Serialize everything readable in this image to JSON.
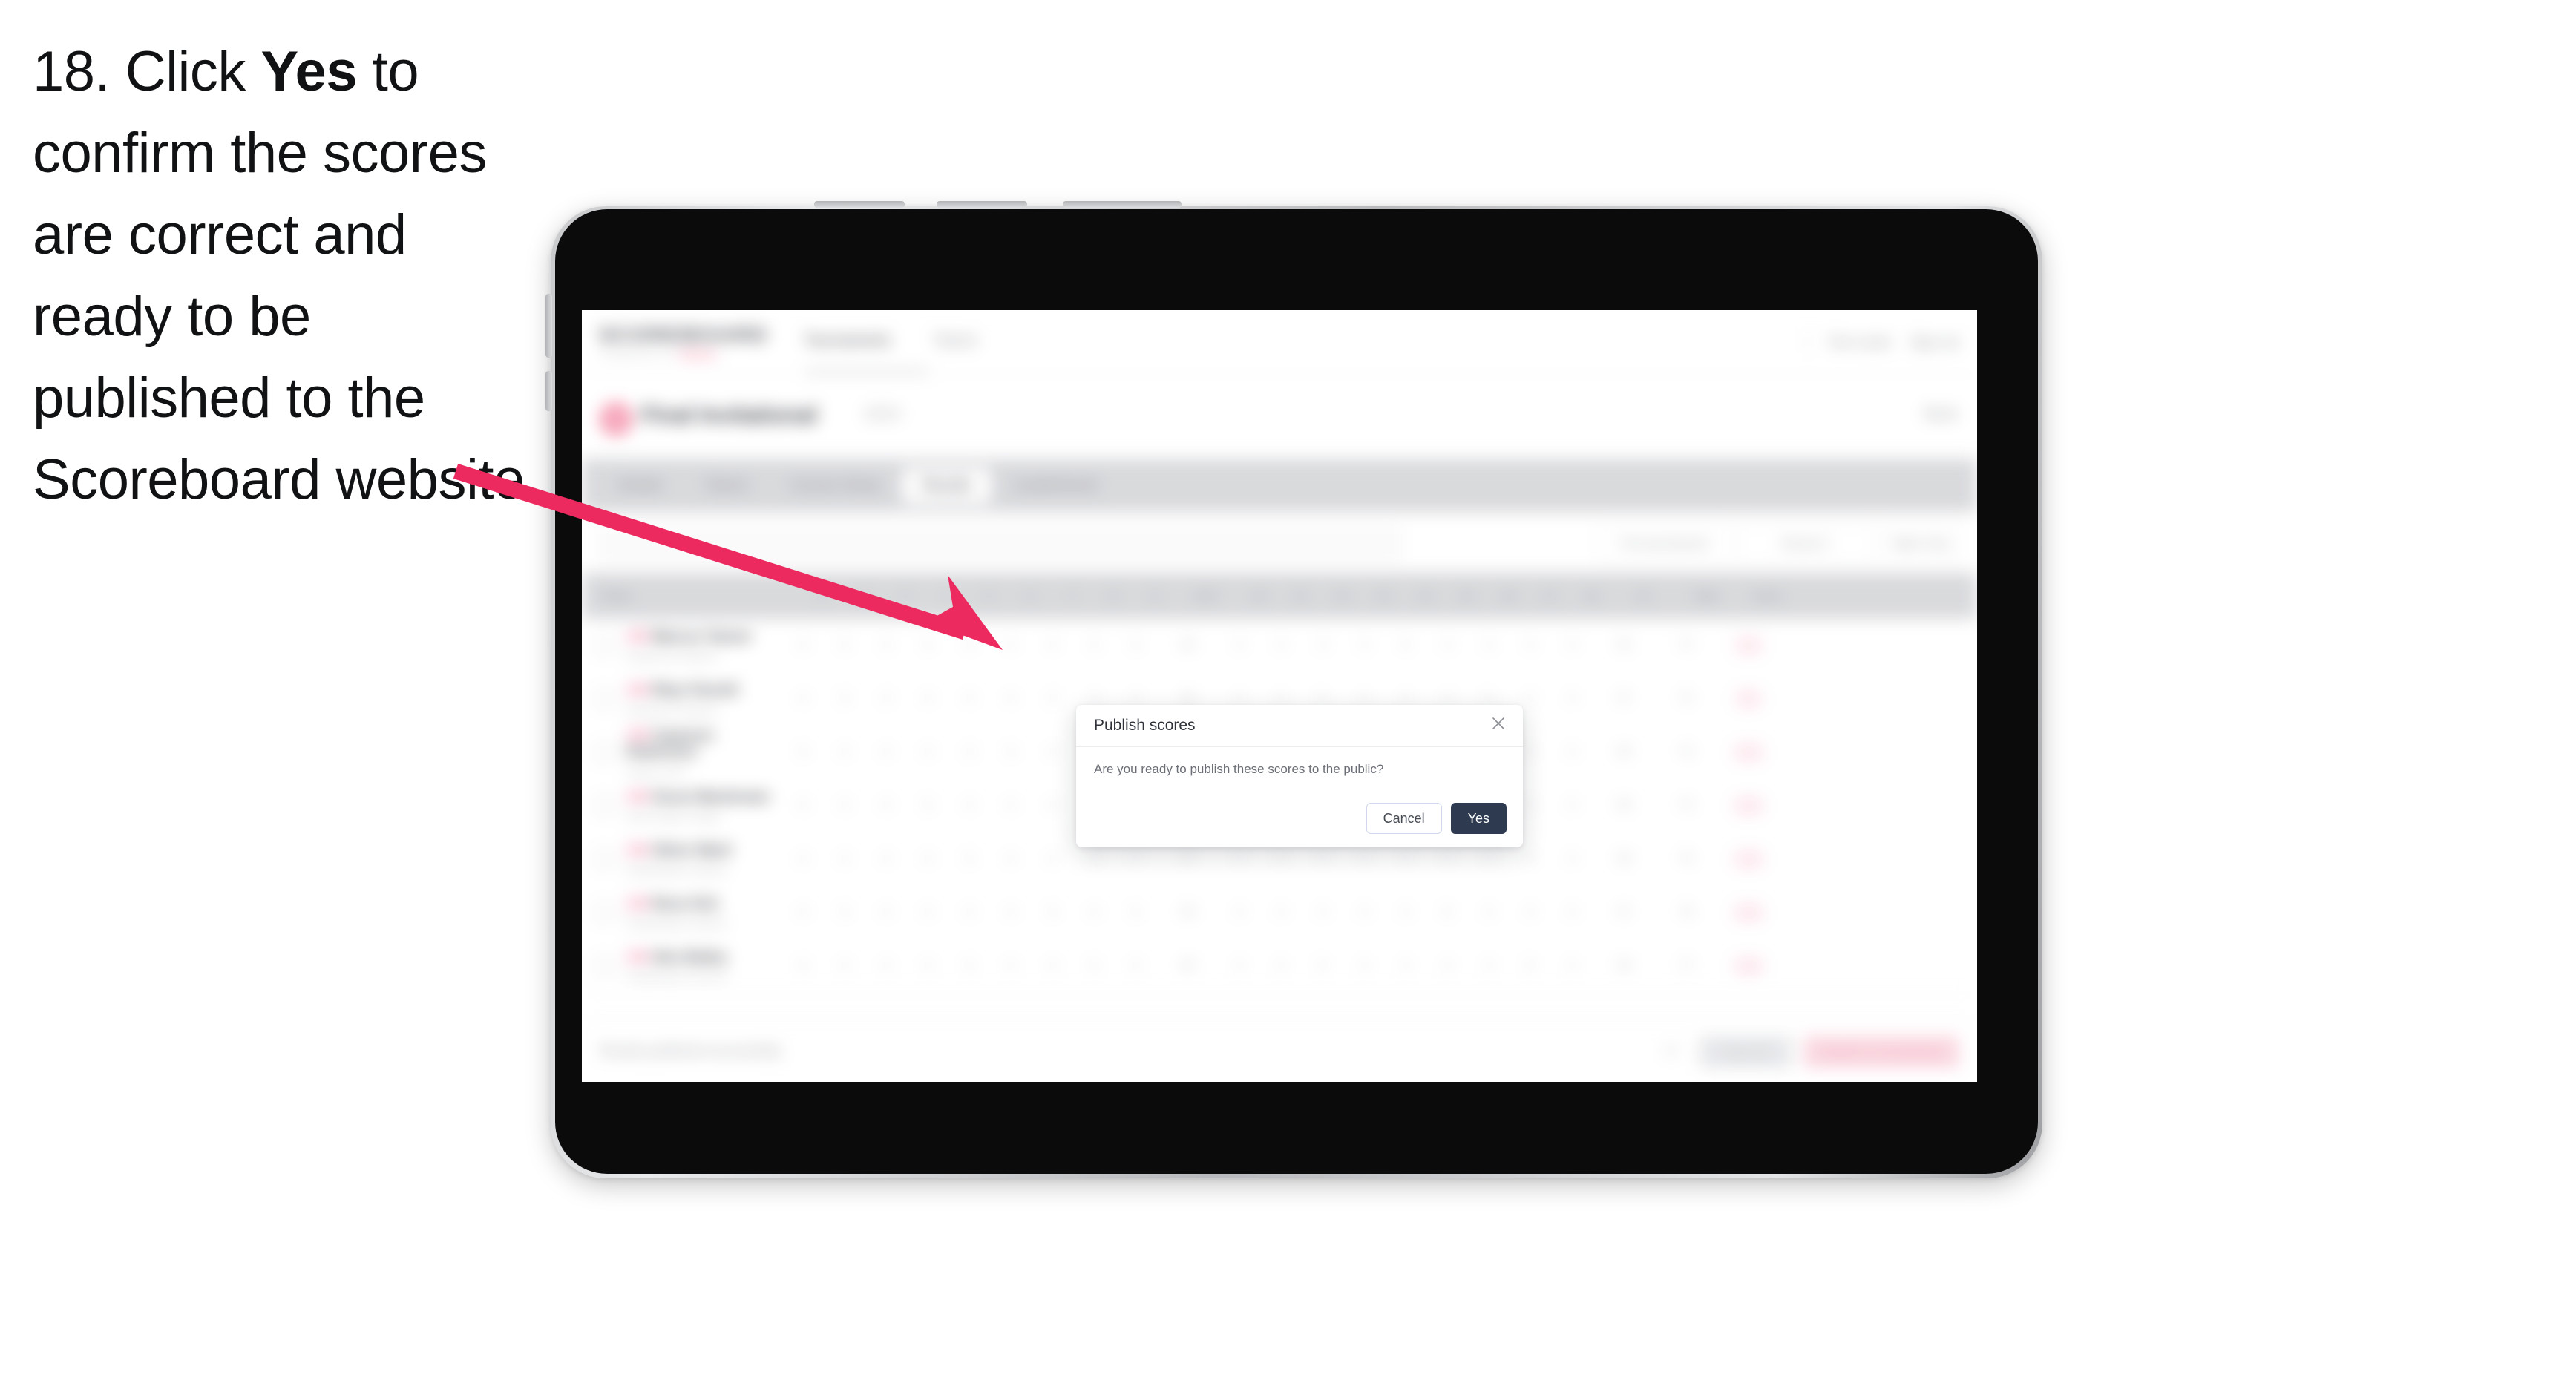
{
  "instruction": {
    "prefix": "18. Click ",
    "keyword": "Yes",
    "suffix": " to confirm the scores are correct and ready to be published to the Scoreboard website."
  },
  "colors": {
    "arrow": "#ED2A5F",
    "accent_pink": "#EF3B68",
    "primary_button": "#2D3A50",
    "device_frame": "#0B0B0C"
  },
  "modal": {
    "title": "Publish scores",
    "message": "Are you ready to publish these scores to the public?",
    "close_label": "close-icon",
    "cancel_label": "Cancel",
    "confirm_label": "Yes"
  },
  "app": {
    "brand": {
      "name": "SCOREBOARD",
      "tagline_plain": "POWERED BY",
      "tagline_accent": "TRACK"
    },
    "topnav": [
      {
        "label": "Tournaments"
      },
      {
        "label": "Teams"
      }
    ],
    "topright": [
      {
        "label": "Tom Lewis"
      },
      {
        "label": "Sign out"
      }
    ],
    "page_header": {
      "title": "Final Invitational",
      "subtitle": "2024",
      "right_action": "Back"
    },
    "tabs": [
      {
        "label": "Details"
      },
      {
        "label": "Teams"
      },
      {
        "label": "Course Setup"
      },
      {
        "label": "Results"
      },
      {
        "label": "Leaderboard"
      }
    ],
    "selected_tab": "Results",
    "filters": {
      "search_placeholder": "Search players",
      "control_1": "Pre-tournament",
      "control_2": "Round 1",
      "control_3": "Table Only"
    },
    "table": {
      "columns": [
        "Player",
        "1",
        "2",
        "3",
        "4",
        "5",
        "6",
        "7",
        "8",
        "9",
        "OUT",
        "10",
        "11",
        "12",
        "13",
        "14",
        "15",
        "16",
        "17",
        "18",
        "IN",
        "Total",
        "Score"
      ],
      "rows": [
        {
          "name_prefix": "AM",
          "name": "Marcus Tanner",
          "team": "Eastwood Academy",
          "out": "36",
          "in": "35",
          "total": "71",
          "score": "-1"
        },
        {
          "name_prefix": "AM",
          "name": "Rhys Parnell",
          "team": "Eastwood Academy",
          "out": "35",
          "in": "37",
          "total": "72",
          "score": "E"
        },
        {
          "name_prefix": "AM",
          "name": "Cameron Robertson",
          "team": "Harbor Point",
          "out": "37",
          "in": "36",
          "total": "73",
          "score": "+1"
        },
        {
          "name_prefix": "AM",
          "name": "Oscar Maclennan",
          "team": "North Ridge College",
          "out": "38",
          "in": "36",
          "total": "74",
          "score": "+2"
        },
        {
          "name_prefix": "AM",
          "name": "Oliver Ward",
          "team": "Kingsbridge Academy",
          "out": "37",
          "in": "38",
          "total": "75",
          "score": "+3"
        },
        {
          "name_prefix": "AM",
          "name": "Ross Kirk",
          "team": "Kingsbridge Academy",
          "out": "39",
          "in": "37",
          "total": "76",
          "score": "+4"
        },
        {
          "name_prefix": "AM",
          "name": "Alex Bailey",
          "team": "Kingsbridge Academy",
          "out": "39",
          "in": "38",
          "total": "77",
          "score": "+5"
        }
      ]
    },
    "footer": {
      "status": "Results published successfully",
      "count": "14",
      "secondary_button": "Save all",
      "primary_button": "Publish to Scoreboard"
    }
  }
}
